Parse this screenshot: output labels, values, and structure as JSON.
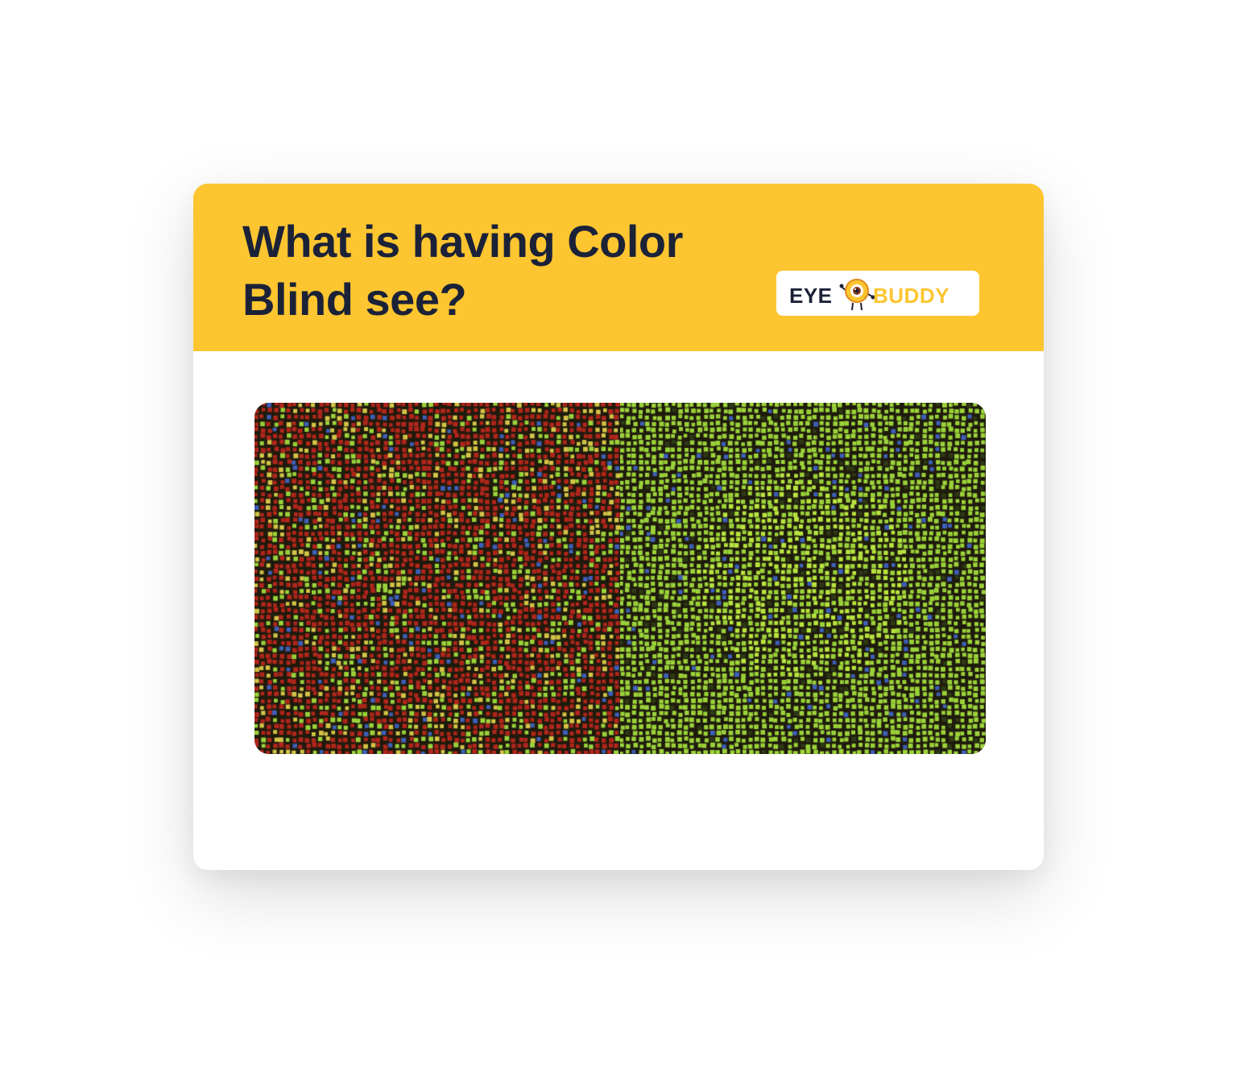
{
  "header": {
    "title": "What is having Color Blind see?"
  },
  "logo": {
    "eye_word": "EYE",
    "buddy_word": "BUDDY",
    "icon": "eyeball-mascot-icon"
  },
  "illustration": {
    "left_panel": "color-vision-test-plate-icon",
    "right_panel": "color-blind-view-plate-icon"
  },
  "colors": {
    "header_background": "#FDC530",
    "title_text": "#1B2238",
    "logo_eye_text": "#1B2238",
    "logo_buddy_text": "#FDC530",
    "mosaic_red": "#B0261C",
    "mosaic_green": "#9BD23A",
    "mosaic_blue": "#3F5FB8",
    "mosaic_dark": "#1E1A0C"
  }
}
